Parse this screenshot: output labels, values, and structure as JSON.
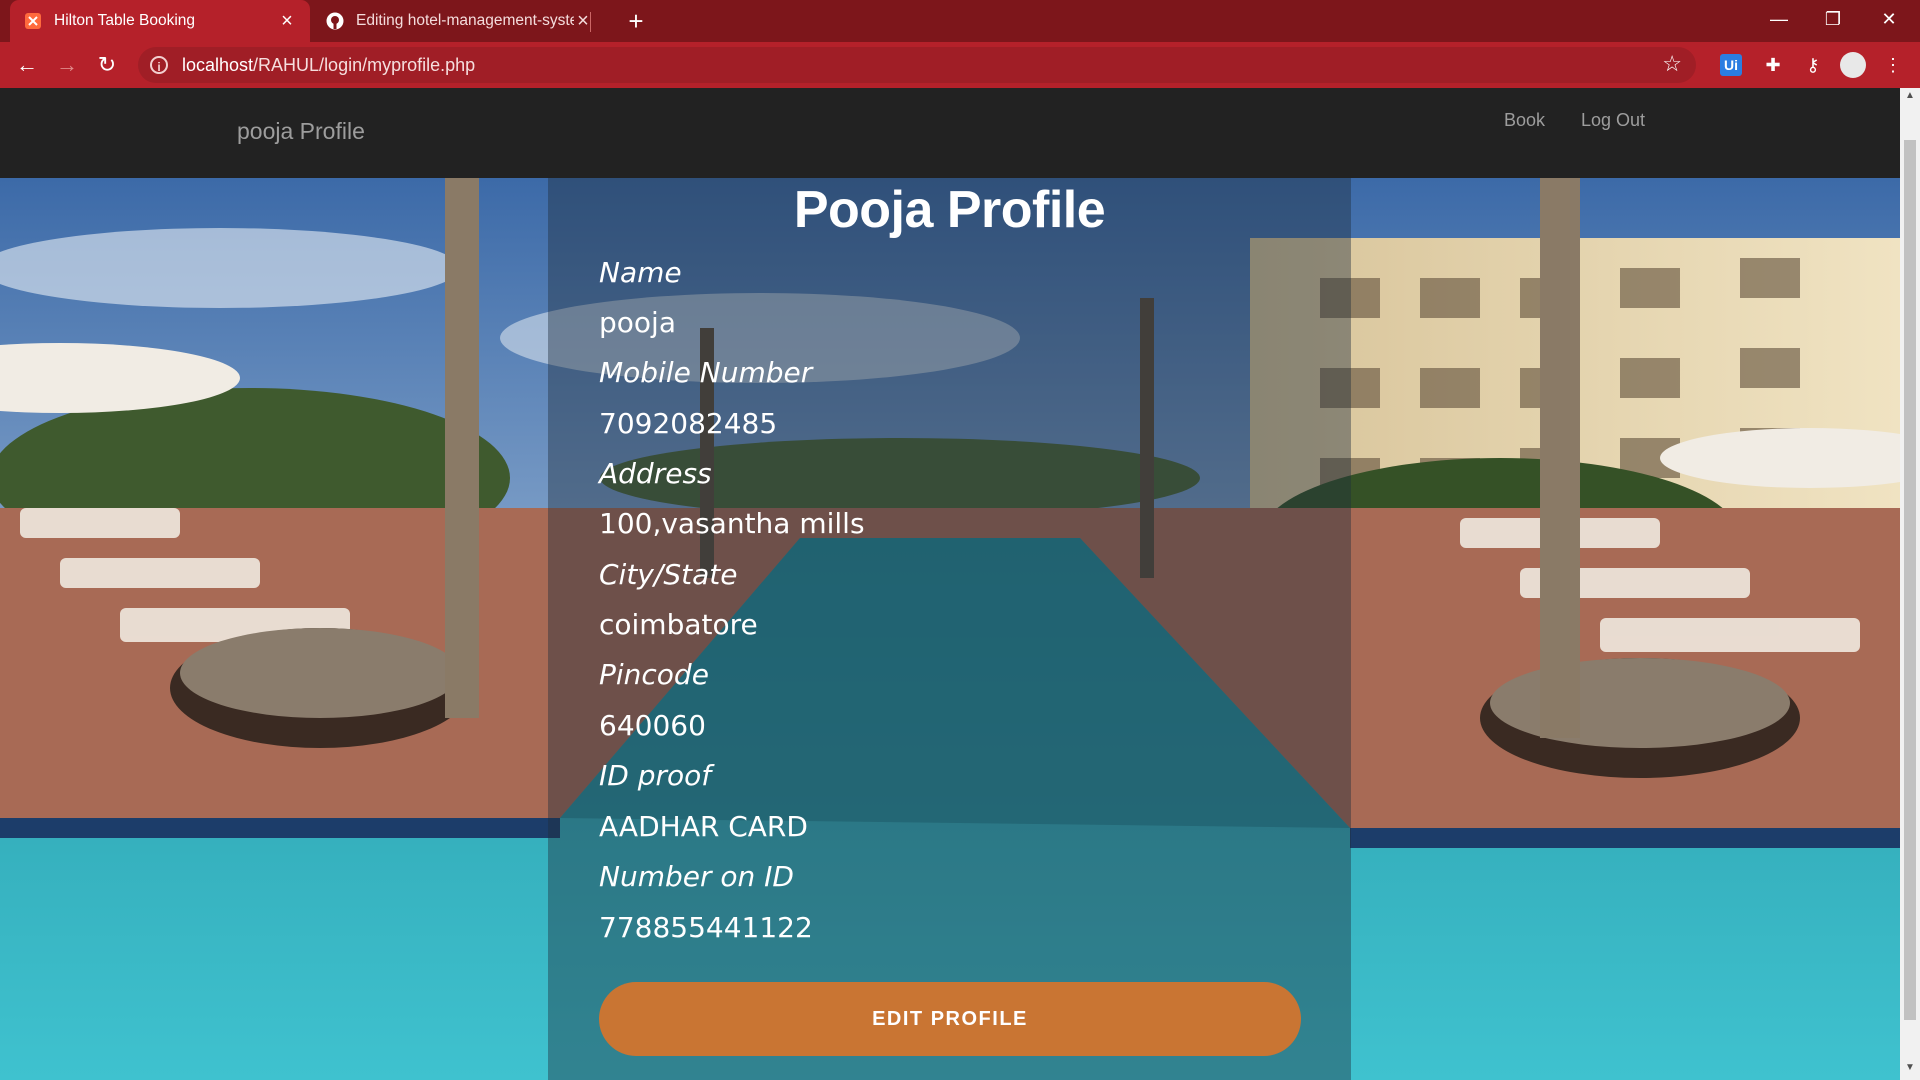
{
  "browser": {
    "tabs": [
      {
        "title": "Hilton Table Booking",
        "active": true,
        "icon": "site-favicon"
      },
      {
        "title": "Editing hotel-management-syste",
        "active": false,
        "icon": "github-icon"
      }
    ],
    "url": {
      "host": "localhost",
      "path": "/RAHUL/login/myprofile.php"
    }
  },
  "nav": {
    "brand": "pooja Profile",
    "links": [
      "Book",
      "Log Out"
    ]
  },
  "profile": {
    "title": "Pooja Profile",
    "fields": [
      {
        "label": "Name",
        "value": "pooja"
      },
      {
        "label": "Mobile Number",
        "value": "7092082485"
      },
      {
        "label": "Address",
        "value": "100,vasantha mills"
      },
      {
        "label": "City/State",
        "value": "coimbatore"
      },
      {
        "label": "Pincode",
        "value": "640060"
      },
      {
        "label": "ID proof",
        "value": "AADHAR CARD"
      },
      {
        "label": "Number on ID",
        "value": "778855441122"
      }
    ],
    "button": "EDIT PROFILE"
  }
}
